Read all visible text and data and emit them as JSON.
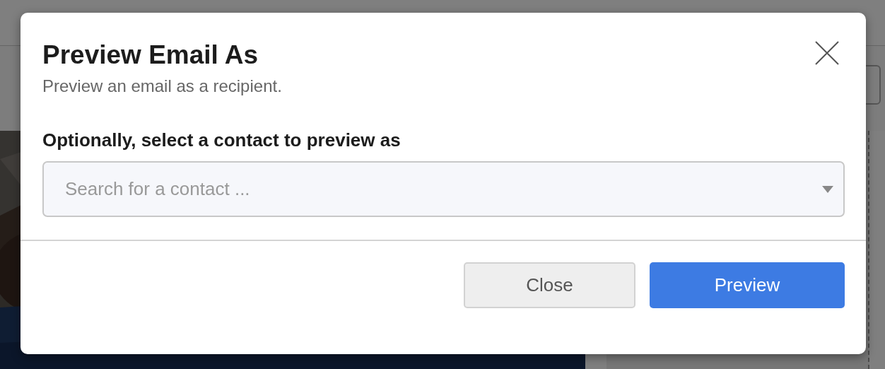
{
  "dialog": {
    "title": "Preview Email As",
    "subtitle": "Preview an email as a recipient.",
    "contact_field": {
      "label": "Optionally, select a contact to preview as",
      "placeholder": "Search for a contact ..."
    },
    "buttons": [
      {
        "label": "Close",
        "kind": "secondary"
      },
      {
        "label": "Preview",
        "kind": "primary"
      }
    ]
  }
}
